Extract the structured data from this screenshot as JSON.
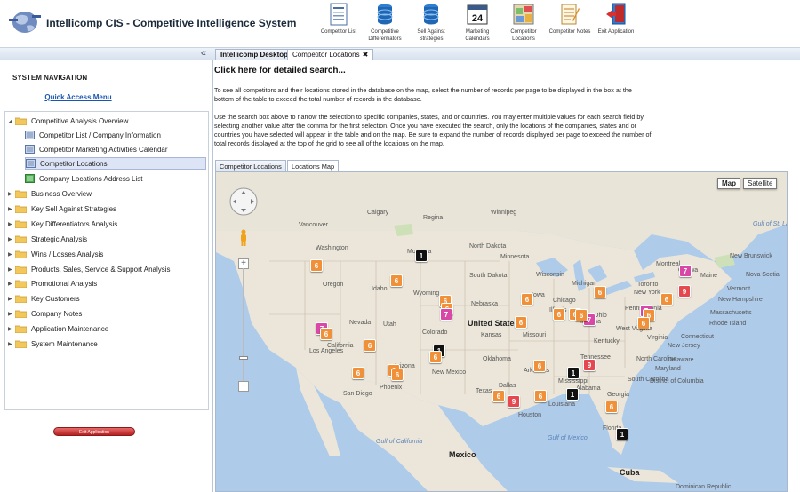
{
  "app": {
    "title": "Intellicomp CIS - Competitive Intelligence System"
  },
  "toolbar": [
    {
      "label": "Competitor List",
      "icon": "list-document-icon"
    },
    {
      "label": "Competitive Differentiators",
      "icon": "database-icon"
    },
    {
      "label": "Sell Against Strategies",
      "icon": "database-icon"
    },
    {
      "label": "Marketing Calendars",
      "icon": "calendar-icon",
      "day": "24"
    },
    {
      "label": "Competitor Locations",
      "icon": "map-icon"
    },
    {
      "label": "Competitor Notes",
      "icon": "notepad-icon"
    },
    {
      "label": "Exit Application",
      "icon": "exit-door-icon"
    }
  ],
  "sidebar": {
    "collapse_icon": "«",
    "title": "SYSTEM NAVIGATION",
    "quick_access": "Quick Access Menu",
    "items": [
      {
        "label": "Competitive Analysis Overview",
        "type": "folder",
        "expanded": true
      },
      {
        "label": "Competitor List / Company Information",
        "type": "page"
      },
      {
        "label": "Competitor Marketing Activities Calendar",
        "type": "page"
      },
      {
        "label": "Competitor Locations",
        "type": "page",
        "selected": true
      },
      {
        "label": "Company Locations Address List",
        "type": "page"
      },
      {
        "label": "Business Overview",
        "type": "folder"
      },
      {
        "label": "Key Sell Against Strategies",
        "type": "folder"
      },
      {
        "label": "Key Differentiators Analysis",
        "type": "folder"
      },
      {
        "label": "Strategic Analysis",
        "type": "folder"
      },
      {
        "label": "Wins / Losses Analysis",
        "type": "folder"
      },
      {
        "label": "Products, Sales, Service & Support Analysis",
        "type": "folder"
      },
      {
        "label": "Promotional Analysis",
        "type": "folder"
      },
      {
        "label": "Key Customers",
        "type": "folder"
      },
      {
        "label": "Company Notes",
        "type": "folder"
      },
      {
        "label": "Application Maintenance",
        "type": "folder"
      },
      {
        "label": "System Maintenance",
        "type": "folder"
      }
    ],
    "exit_button": "Exit Application"
  },
  "tabs": [
    {
      "label": "Intellicomp Desktop",
      "active": false
    },
    {
      "label": "Competitor Locations",
      "active": true,
      "close": "✖"
    }
  ],
  "content": {
    "search_link": "Click here for detailed search...",
    "para1_line1": "To see all competitors and their locations stored in the database on the map, select the number of records per page to be displayed in the box at the",
    "para1_line2": "bottom of the table to exceed the total number of records in the database.",
    "para2_line1": "Use the search box above to narrow the selection to specific companies, states, and or countries. You may enter multiple values for each search field by",
    "para2_line2": "selecting another value after the comma for the first selection.  Once you have executed the search, only the locations of the companies, states and or",
    "para2_line3": "countries you have selected will appear in the table and on the map. Be sure to expand the number of records displayed per page to exceed the number of",
    "para2_line4": "total records displayed at the top of the grid to see all of the locations on the map.",
    "subtabs": [
      "Competitor Locations",
      "Locations Map"
    ]
  },
  "map": {
    "type_buttons": [
      "Map",
      "Satellite"
    ],
    "zoom_in": "+",
    "zoom_out": "−",
    "country_labels": [
      "United States",
      "Mexico",
      "Cuba"
    ],
    "state_labels": [
      "Washington",
      "Oregon",
      "Idaho",
      "Montana",
      "Wyoming",
      "Nevada",
      "California",
      "Utah",
      "Colorado",
      "Arizona",
      "New Mexico",
      "North Dakota",
      "South Dakota",
      "Nebraska",
      "Kansas",
      "Oklahoma",
      "Texas",
      "Minnesota",
      "Iowa",
      "Missouri",
      "Arkansas",
      "Louisiana",
      "Mississippi",
      "Alabama",
      "Georgia",
      "Florida",
      "Tennessee",
      "Kentucky",
      "Illinois",
      "Indiana",
      "Ohio",
      "Michigan",
      "Wisconsin",
      "Pennsylvania",
      "New York",
      "Virginia",
      "West Virginia",
      "North Carolina",
      "South Carolina",
      "Maine",
      "Vermont",
      "New Hampshire",
      "Massachusetts",
      "Connecticut",
      "Rhode Island",
      "New Jersey",
      "Delaware",
      "Maryland",
      "District of Columbia",
      "New Brunswick",
      "Nova Scotia"
    ],
    "city_labels": [
      "Calgary",
      "Vancouver",
      "Regina",
      "Winnipeg",
      "Chicago",
      "Toronto",
      "Montreal",
      "Los Angeles",
      "San Diego",
      "Phoenix",
      "Dallas",
      "Houston",
      "Ottawa",
      "Dominican Republic"
    ],
    "water_labels": [
      "Gulf of St. Lawrence",
      "Gulf of Mexico",
      "Gulf of California"
    ],
    "markers": [
      {
        "label": "1",
        "color": "black"
      },
      {
        "label": "6",
        "color": "orange"
      },
      {
        "label": "6",
        "color": "orange"
      },
      {
        "label": "6",
        "color": "orange"
      },
      {
        "label": "6",
        "color": "orange"
      },
      {
        "label": "7",
        "color": "pink"
      },
      {
        "label": "6",
        "color": "orange"
      },
      {
        "label": "6",
        "color": "orange"
      },
      {
        "label": "6",
        "color": "orange"
      },
      {
        "label": "7",
        "color": "pink"
      },
      {
        "label": "6",
        "color": "orange"
      },
      {
        "label": "6",
        "color": "orange"
      },
      {
        "label": "6",
        "color": "orange"
      },
      {
        "label": "7",
        "color": "pink"
      },
      {
        "label": "9",
        "color": "red"
      },
      {
        "label": "6",
        "color": "orange"
      },
      {
        "label": "7",
        "color": "pink"
      },
      {
        "label": "6",
        "color": "orange"
      },
      {
        "label": "6",
        "color": "orange"
      },
      {
        "label": "1",
        "color": "black"
      },
      {
        "label": "6",
        "color": "orange"
      },
      {
        "label": "6",
        "color": "orange"
      },
      {
        "label": "6",
        "color": "orange"
      },
      {
        "label": "6",
        "color": "orange"
      },
      {
        "label": "6",
        "color": "orange"
      },
      {
        "label": "1",
        "color": "black"
      },
      {
        "label": "9",
        "color": "red"
      },
      {
        "label": "1",
        "color": "black"
      },
      {
        "label": "6",
        "color": "orange"
      },
      {
        "label": "9",
        "color": "red"
      },
      {
        "label": "6",
        "color": "orange"
      },
      {
        "label": "6",
        "color": "orange"
      },
      {
        "label": "6",
        "color": "orange"
      },
      {
        "label": "1",
        "color": "black"
      }
    ]
  }
}
